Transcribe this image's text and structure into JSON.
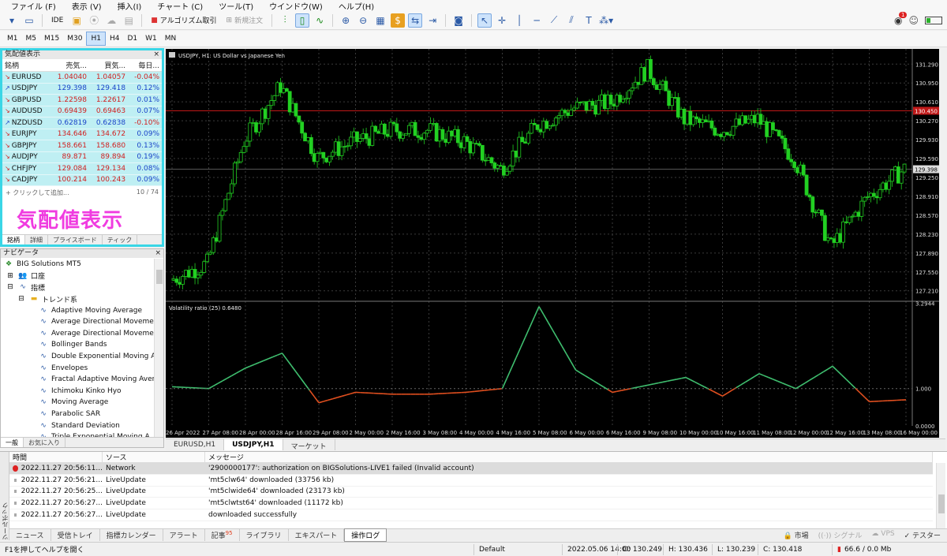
{
  "menu": [
    "ファイル (F)",
    "表示 (V)",
    "挿入(I)",
    "チャート (C)",
    "ツール(T)",
    "ウインドウ(W)",
    "ヘルプ(H)"
  ],
  "toolbar": {
    "ide_label": "IDE",
    "algo_label": "アルゴリズム取引",
    "new_order_label": "新規注文",
    "notification_count": "1"
  },
  "timeframes": [
    "M1",
    "M5",
    "M15",
    "M30",
    "H1",
    "H4",
    "D1",
    "W1",
    "MN"
  ],
  "active_timeframe": "H1",
  "market_watch": {
    "title": "気配値表示",
    "columns": [
      "銘柄",
      "売気...",
      "買気...",
      "毎日..."
    ],
    "rows": [
      {
        "symbol": "EURUSD",
        "bid": "1.04040",
        "ask": "1.04057",
        "change": "-0.04%",
        "dir": "dn"
      },
      {
        "symbol": "USDJPY",
        "bid": "129.398",
        "ask": "129.418",
        "change": "0.12%",
        "dir": "up"
      },
      {
        "symbol": "GBPUSD",
        "bid": "1.22598",
        "ask": "1.22617",
        "change": "0.01%",
        "dir": "dn"
      },
      {
        "symbol": "AUDUSD",
        "bid": "0.69439",
        "ask": "0.69463",
        "change": "0.07%",
        "dir": "dn"
      },
      {
        "symbol": "NZDUSD",
        "bid": "0.62819",
        "ask": "0.62838",
        "change": "-0.10%",
        "dir": "up"
      },
      {
        "symbol": "EURJPY",
        "bid": "134.646",
        "ask": "134.672",
        "change": "0.09%",
        "dir": "dn"
      },
      {
        "symbol": "GBPJPY",
        "bid": "158.661",
        "ask": "158.680",
        "change": "0.13%",
        "dir": "dn"
      },
      {
        "symbol": "AUDJPY",
        "bid": "89.871",
        "ask": "89.894",
        "change": "0.19%",
        "dir": "dn"
      },
      {
        "symbol": "CHFJPY",
        "bid": "129.084",
        "ask": "129.134",
        "change": "0.08%",
        "dir": "dn"
      },
      {
        "symbol": "CADJPY",
        "bid": "100.214",
        "ask": "100.243",
        "change": "0.09%",
        "dir": "dn"
      }
    ],
    "add_label": "+ クリックして追加...",
    "count": "10 / 74",
    "overlay_text": "気配値表示",
    "tabs": [
      "銘柄",
      "詳細",
      "プライスボード",
      "ティック"
    ]
  },
  "navigator": {
    "title": "ナビゲータ",
    "root": "BIG Solutions MT5",
    "account": "口座",
    "indicators": "指標",
    "trend_folder": "トレンド系",
    "items": [
      "Adaptive Moving Average",
      "Average Directional Moveme",
      "Average Directional Moveme",
      "Bollinger Bands",
      "Double Exponential Moving A",
      "Envelopes",
      "Fractal Adaptive Moving Aver",
      "Ichimoku Kinko Hyo",
      "Moving Average",
      "Parabolic SAR",
      "Standard Deviation",
      "Triple Exponential Moving A"
    ],
    "tabs": [
      "一般",
      "お気に入り"
    ]
  },
  "chart": {
    "title": "USDJPY, H1: US Dollar vs Japanese Yen",
    "indicator_label": "Volatility ratio (25) 0.6480",
    "price_ticks": [
      "131.290",
      "130.950",
      "130.610",
      "130.270",
      "129.930",
      "129.590",
      "129.250",
      "128.910",
      "128.570",
      "128.230",
      "127.890",
      "127.550",
      "127.210"
    ],
    "current_price": "129.398",
    "red_line_label": "130.450",
    "ind_ticks": [
      "3.2944",
      "1.000",
      "0.0000"
    ],
    "x_ticks": [
      "26 Apr 2022",
      "27 Apr 08:00",
      "28 Apr 00:00",
      "28 Apr 16:00",
      "29 Apr 08:00",
      "2 May 00:00",
      "2 May 16:00",
      "3 May 08:00",
      "4 May 00:00",
      "4 May 16:00",
      "5 May 08:00",
      "6 May 00:00",
      "6 May 16:00",
      "9 May 08:00",
      "10 May 00:00",
      "10 May 16:00",
      "11 May 08:00",
      "12 May 00:00",
      "12 May 16:00",
      "13 May 08:00",
      "16 May 00:00"
    ],
    "colors": {
      "bull": "#22d022",
      "bear": "#22d022",
      "ind_green": "#3fbf6f",
      "ind_red": "#e04f1f",
      "grid": "#3a3a3a"
    }
  },
  "chart_data": {
    "type": "line",
    "title": "USDJPY, H1: US Dollar vs Japanese Yen",
    "xlabel": "",
    "ylabel": "",
    "ylim": [
      127.05,
      131.45
    ],
    "series": [
      {
        "name": "USDJPY",
        "x": [
          "26 Apr 2022",
          "27 Apr 08:00",
          "28 Apr 00:00",
          "28 Apr 16:00",
          "29 Apr 08:00",
          "2 May 00:00",
          "2 May 16:00",
          "3 May 08:00",
          "4 May 00:00",
          "4 May 16:00",
          "5 May 08:00",
          "6 May 00:00",
          "6 May 16:00",
          "9 May 08:00",
          "10 May 00:00",
          "10 May 16:00",
          "11 May 08:00",
          "12 May 00:00",
          "12 May 16:00",
          "13 May 08:00",
          "16 May 00:00"
        ],
        "values": [
          127.4,
          127.7,
          129.9,
          130.9,
          129.6,
          129.9,
          130.1,
          130.1,
          129.9,
          129.4,
          130.2,
          130.5,
          130.6,
          131.2,
          130.3,
          130.1,
          130.3,
          129.6,
          128.0,
          128.9,
          129.4
        ]
      },
      {
        "name": "Volatility ratio (25)",
        "x": [
          "26 Apr 2022",
          "27 Apr 08:00",
          "28 Apr 00:00",
          "28 Apr 16:00",
          "29 Apr 08:00",
          "2 May 00:00",
          "2 May 16:00",
          "3 May 08:00",
          "4 May 00:00",
          "4 May 16:00",
          "5 May 08:00",
          "6 May 00:00",
          "6 May 16:00",
          "9 May 08:00",
          "10 May 00:00",
          "10 May 16:00",
          "11 May 08:00",
          "12 May 00:00",
          "12 May 16:00",
          "13 May 08:00",
          "16 May 00:00"
        ],
        "values": [
          1.05,
          1.0,
          1.55,
          1.95,
          0.62,
          0.9,
          0.85,
          0.85,
          0.9,
          1.0,
          3.2,
          1.5,
          0.9,
          1.1,
          1.3,
          0.8,
          1.4,
          1.0,
          1.6,
          0.65,
          0.7
        ]
      }
    ]
  },
  "chart_tabs": [
    "EURUSD,H1",
    "USDJPY,H1",
    "マーケット"
  ],
  "toolbox": {
    "side_label": "ツールボックス",
    "columns": [
      "時間",
      "ソース",
      "メッセージ"
    ],
    "rows": [
      {
        "time": "2022.11.27 20:56:11...",
        "source": "Network",
        "message": "'2900000177': authorization on BIGSolutions-LIVE1 failed (Invalid account)",
        "level": "error"
      },
      {
        "time": "2022.11.27 20:56:21...",
        "source": "LiveUpdate",
        "message": "'mt5clw64' downloaded (33756 kb)",
        "level": "info"
      },
      {
        "time": "2022.11.27 20:56:25...",
        "source": "LiveUpdate",
        "message": "'mt5clwide64' downloaded (23173 kb)",
        "level": "info"
      },
      {
        "time": "2022.11.27 20:56:27...",
        "source": "LiveUpdate",
        "message": "'mt5clwtst64' downloaded (11172 kb)",
        "level": "info"
      },
      {
        "time": "2022.11.27 20:56:27...",
        "source": "LiveUpdate",
        "message": "downloaded successfully",
        "level": "info"
      }
    ],
    "tabs": [
      "ニュース",
      "受信トレイ",
      "指標カレンダー",
      "アラート",
      "記事",
      "ライブラリ",
      "エキスパート",
      "操作ログ"
    ],
    "article_badge": "95",
    "right_items": [
      "市場",
      "シグナル",
      "VPS",
      "テスター"
    ]
  },
  "status": {
    "help": "F1を押してヘルプを開く",
    "profile": "Default",
    "datetime": "2022.05.06 14:00",
    "open": "O: 130.249",
    "high": "H: 130.436",
    "low": "L: 130.239",
    "close": "C: 130.418",
    "net": "66.6 / 0.0 Mb"
  }
}
